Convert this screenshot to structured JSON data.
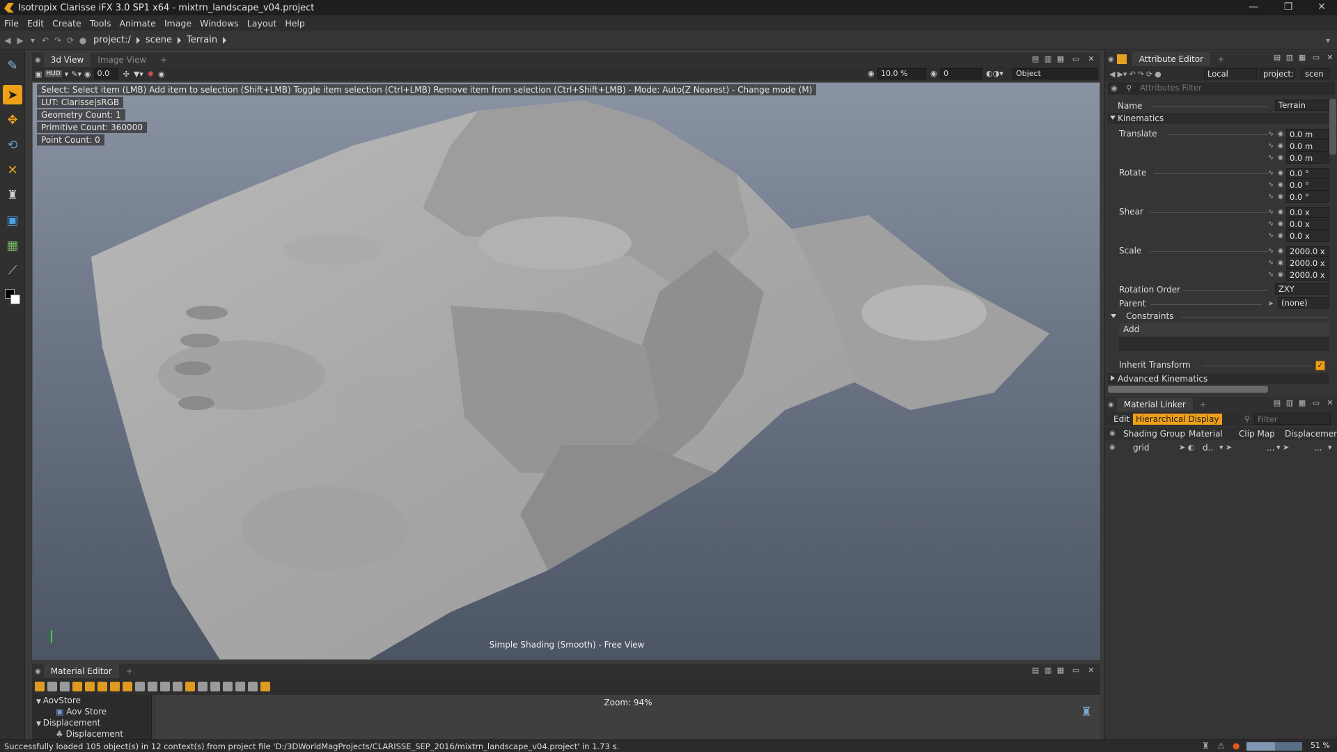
{
  "window": {
    "title": "Isotropix Clarisse iFX 3.0 SP1 x64  - mixtrn_landscape_v04.project",
    "controls": [
      "—",
      "❐",
      "✕"
    ]
  },
  "menu": [
    "File",
    "Edit",
    "Create",
    "Tools",
    "Animate",
    "Image",
    "Windows",
    "Layout",
    "Help"
  ],
  "breadcrumb": [
    "project:/",
    "scene",
    "Terrain"
  ],
  "viewport": {
    "tabs": [
      "3d View",
      "Image View",
      "+"
    ],
    "hud_field": "0.0",
    "zoom_field": "10.0 %",
    "frame_field": "0",
    "select_mode": "Object",
    "hud_label": "HUD",
    "hud": {
      "select": "Select: Select item (LMB)  Add item to selection (Shift+LMB)  Toggle item selection (Ctrl+LMB)  Remove item from selection (Ctrl+Shift+LMB)  - Mode: Auto(Z Nearest) - Change mode (M)",
      "lut": "LUT: Clarisse|sRGB",
      "geometry": "Geometry Count: 1",
      "primitive": "Primitive Count: 360000",
      "point": "Point Count: 0"
    },
    "footer": "Simple Shading (Smooth) - Free View"
  },
  "material_editor": {
    "tabs": [
      "Material Editor",
      "+"
    ],
    "tree": [
      {
        "label": "AovStore",
        "level": 0
      },
      {
        "label": "Aov Store",
        "level": 1
      },
      {
        "label": "Displacement",
        "level": 0
      },
      {
        "label": "Displacement",
        "level": 1
      }
    ],
    "zoom": "Zoom: 94%"
  },
  "status": {
    "message": "Successfully loaded 105 object(s) in 12 context(s) from project file 'D:/3DWorldMagProjects/CLARISSE_SEP_2016/mixtrn_landscape_v04.project' in 1.73 s.",
    "progress_label": "51 %",
    "progress": 0.51
  },
  "attribute_editor": {
    "tabs": [
      "Attribute Editor",
      "+"
    ],
    "space": "Local",
    "path": "project:/",
    "context": "scen",
    "filter_placeholder": "Attributes Filter",
    "name_label": "Name",
    "name_value": "Terrain",
    "kinematics": "Kinematics",
    "translate": {
      "label": "Translate",
      "values": [
        "0.0 m",
        "0.0 m",
        "0.0 m"
      ]
    },
    "rotate": {
      "label": "Rotate",
      "values": [
        "0.0 °",
        "0.0 °",
        "0.0 °"
      ]
    },
    "shear": {
      "label": "Shear",
      "values": [
        "0.0 x",
        "0.0 x",
        "0.0 x"
      ]
    },
    "scale": {
      "label": "Scale",
      "values": [
        "2000.0 x",
        "2000.0 x",
        "2000.0 x"
      ]
    },
    "rotation_order": {
      "label": "Rotation Order",
      "value": "ZXY"
    },
    "parent": {
      "label": "Parent",
      "value": "(none)"
    },
    "constraints": "Constraints",
    "add": "Add",
    "inherit": {
      "label": "Inherit Transform",
      "checked": true
    },
    "advanced": "Advanced Kinematics"
  },
  "material_linker": {
    "tabs": [
      "Material Linker",
      "+"
    ],
    "edit": "Edit",
    "display_mode": "Hierarchical Display",
    "filter_placeholder": "Filter",
    "columns": [
      "Shading Group",
      "Material",
      "Clip Map",
      "Displacement"
    ],
    "rows": [
      {
        "name": "grid",
        "material": "d..",
        "clip": "...",
        "disp": "..."
      }
    ]
  },
  "colors": {
    "accent": "#f0a018",
    "bg": "#353535",
    "viewport_top": "#8a93a4",
    "viewport_bottom": "#4c5564"
  }
}
